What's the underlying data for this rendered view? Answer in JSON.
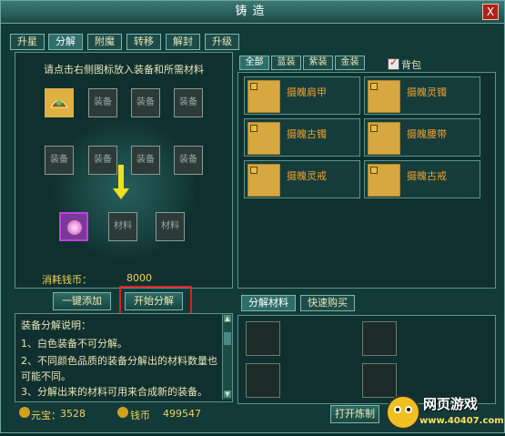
{
  "window": {
    "title": "铸造",
    "close_label": "X"
  },
  "tabs": [
    {
      "label": "升星",
      "active": false
    },
    {
      "label": "分解",
      "active": true
    },
    {
      "label": "附魔",
      "active": false
    },
    {
      "label": "转移",
      "active": false
    },
    {
      "label": "解封",
      "active": false
    },
    {
      "label": "升级",
      "active": false
    }
  ],
  "left": {
    "hint": "请点击右侧图标放入装备和所需材料",
    "slot_label_equip": "装备",
    "slot_label_material": "材料",
    "cost_label": "消耗钱币：",
    "cost_value": "8000"
  },
  "buttons": {
    "quick_add": "一键添加",
    "start": "开始分解",
    "open_forge": "打开炼制"
  },
  "description": {
    "title": "装备分解说明：",
    "lines": [
      "1、白色装备不可分解。",
      "2、不同颜色品质的装备分解出的材料数量也",
      "可能不同。",
      "3、分解出来的材料可用来合成新的装备。"
    ],
    "highlight_color": "#e040e0"
  },
  "filters": [
    {
      "label": "全部",
      "active": true
    },
    {
      "label": "蓝装",
      "active": false
    },
    {
      "label": "紫装",
      "active": false
    },
    {
      "label": "金装",
      "active": false
    }
  ],
  "bag": {
    "label": "背包",
    "checked": true
  },
  "equipment": [
    {
      "name": "摄魄肩甲",
      "icon": "shoulder-armor-icon"
    },
    {
      "name": "摄魄灵镯",
      "icon": "bracelet-icon"
    },
    {
      "name": "摄魄古镯",
      "icon": "bracelet-icon"
    },
    {
      "name": "摄魄腰带",
      "icon": "belt-icon"
    },
    {
      "name": "摄魄灵戒",
      "icon": "ring-icon"
    },
    {
      "name": "摄魄古戒",
      "icon": "ring-icon"
    }
  ],
  "bottom_tabs": [
    {
      "label": "分解材料",
      "active": true
    },
    {
      "label": "快速购买",
      "active": false
    }
  ],
  "status": {
    "ingot_label": "元宝：",
    "ingot_value": "3528",
    "coin_label": "钱币",
    "coin_value": "499547"
  },
  "watermark": {
    "name": "网页游戏",
    "url": "www.40407.com"
  },
  "colors": {
    "accent": "#f0d060",
    "item_name": "#f0a030",
    "highlight_box": "#e02020"
  }
}
